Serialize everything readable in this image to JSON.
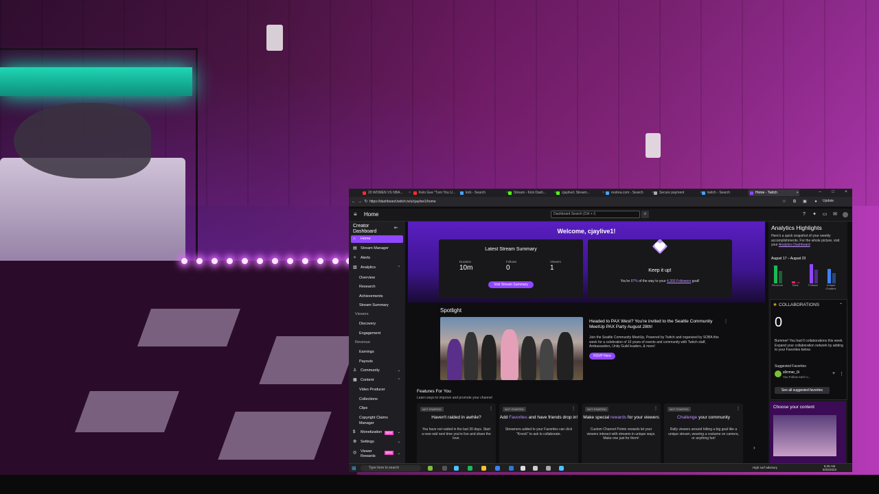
{
  "browser": {
    "tabs": [
      {
        "label": "20 WOMEN VS NBA...",
        "color": "#ff2d2d"
      },
      {
        "label": "Kelo Gee \"Turn You U...",
        "color": "#ff2d2d"
      },
      {
        "label": "kick - Search",
        "color": "#4aa3ff"
      },
      {
        "label": "Stream - Kick Dash...",
        "color": "#53fc18"
      },
      {
        "label": "cjaylive1 Stream...",
        "color": "#53fc18"
      },
      {
        "label": "restrea.com - Search",
        "color": "#4aa3ff"
      },
      {
        "label": "Secure payment",
        "color": "#aaaaaa"
      },
      {
        "label": "twitch - Search",
        "color": "#4aa3ff"
      },
      {
        "label": "Home - Twitch",
        "color": "#9147ff"
      }
    ],
    "url": "https://dashboard.twitch.tv/u/cjaylive1/home",
    "update_label": "Update"
  },
  "topnav": {
    "title": "Home",
    "search_placeholder": "Dashboard Search (Ctrl + /)"
  },
  "sidebar": {
    "header": "Creator Dashboard",
    "items": {
      "home": "Home",
      "stream_manager": "Stream Manager",
      "alerts": "Alerts",
      "analytics": "Analytics",
      "overview": "Overview",
      "research": "Research",
      "achievements": "Achievements",
      "stream_summary": "Stream Summary",
      "viewers_group": "Viewers",
      "discovery": "Discovery",
      "engagement": "Engagement",
      "revenue_group": "Revenue",
      "earnings": "Earnings",
      "payouts": "Payouts",
      "community": "Community",
      "content": "Content",
      "video_producer": "Video Producer",
      "collections": "Collections",
      "clips": "Clips",
      "copyright": "Copyright Claims Manager",
      "monetization": "Monetization",
      "settings": "Settings",
      "viewer_rewards": "Viewer Rewards",
      "new_badge": "NEW"
    }
  },
  "main": {
    "welcome": "Welcome, cjaylive1!",
    "stream_summary": {
      "title": "Latest Stream Summary",
      "duration_label": "Duration",
      "duration_value": "10m",
      "follows_label": "Follows",
      "follows_value": "0",
      "viewers_label": "Viewers",
      "viewers_value": "1",
      "button": "Visit Stream Summary"
    },
    "keep_it_up": {
      "title": "Keep it up!",
      "text_pre": "You're ",
      "percent": "87%",
      "text_mid": " of the way to your ",
      "goal": "4,300 Followers",
      "text_post": " goal!"
    },
    "spotlight": {
      "section": "Spotlight",
      "title": "Headed to PAX West? You're invited to the Seattle Community MeetUp PAX Party August 28th!",
      "body": "Join the Seattle Community MeetUp, Powered by Twitch and organized by SOBA this week for a celebration of 10 years of events and community with Twitch staff, Ambassadors, Unity Guild leaders, & more!",
      "button": "RSVP Here"
    },
    "features": {
      "title": "Features For You",
      "subtitle": "Learn ways to improve and promote your channel",
      "badge": "NOT STARTED",
      "cards": [
        {
          "title": "Haven't raided in awhile?",
          "body": "You have not raided in the last 30 days. Start a new raid next time you're live and share the love."
        },
        {
          "title_pre": "Add ",
          "title_hl": "Favorites",
          "title_post": " and have friends drop in!",
          "body": "Streamers added to your Favorites can click \"Knock\" to ask to collaborate."
        },
        {
          "title_pre": "Make special ",
          "title_hl": "rewards",
          "title_post": " for your viewers",
          "body": "Custom Channel Points rewards let your viewers interact with streams in unique ways. Make one just for them!"
        },
        {
          "title_hl": "Challenge",
          "title_post": " your community",
          "body": "Rally viewers around hitting a big goal like a unique stream, wearing a costume on camera, or anything fun!"
        }
      ]
    }
  },
  "right": {
    "title": "Analytics Highlights",
    "body": "Here's a quick snapshot of your weekly accomplishments. For the whole picture, visit your ",
    "link": "Analytics Dashboard",
    "date_range": "August 17 – August 23",
    "bars": [
      {
        "label": "Revenue",
        "color": "#1db954",
        "value": 22
      },
      {
        "label": "Subs",
        "color": "#e91e63",
        "value": 3
      },
      {
        "label": "Follows",
        "color": "#9147ff",
        "value": 24
      },
      {
        "label": "Unique Chatters",
        "color": "#3b82f6",
        "value": 18
      }
    ],
    "collab": {
      "title": "COLLABORATIONS",
      "count": "0",
      "body": "Bummer! You had 0 collaborations this week. Expand your collaboration network by adding to your Favorites below.",
      "suggested": "Suggested Favorites",
      "user": "s0rrmer_0i",
      "user_sub": "You Follow each o...",
      "button": "See all suggested favorites"
    },
    "choose": "Choose your content"
  },
  "taskbar": {
    "search": "Type here to search",
    "weather": "High surf advisory",
    "time": "5:25 AM",
    "date": "8/25/2023"
  }
}
